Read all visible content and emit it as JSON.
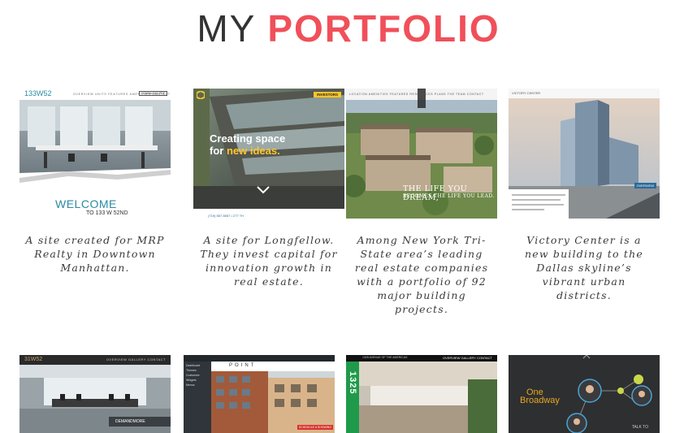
{
  "header": {
    "title_plain": "MY",
    "title_accent": "PORTFOLIO"
  },
  "row1": [
    {
      "caption": "A site created for MRP Realty in Downtown Manhattan.",
      "logo": "133W52",
      "nav": "OVERVIEW   UNITS   FEATURES   AMENITIES   CONTACT",
      "nav_button": "DOWNLOAD PDF",
      "welcome": "WELCOME",
      "address": "TO 133 W 52ND"
    },
    {
      "caption": "A site for Longfellow. They invest capital for innovation growth in real estate.",
      "button": "INVESTORS",
      "headline_1": "Creating space",
      "headline_2_prefix": "for ",
      "headline_2_accent": "new ideas.",
      "foot": "(719) 557-5557 • 277 TH"
    },
    {
      "caption": "Among New York Tri-State area’s leading real estate companies with a portfolio of 92 major building projects.",
      "nav": "LOCATION   AMENITIES   FEATURES   RESIDENCES   PLANS   THE TEAM   CONTACT",
      "tagline_1": "THE LIFE YOU DREAM,",
      "tagline_2": "BECOMES THE LIFE YOU LEAD."
    },
    {
      "caption": "Victory Center is a new building to the Dallas skyline’s vibrant urban districts.",
      "logo": "VICTORY CENTER",
      "badge": "OVERVIEW"
    }
  ],
  "row2": [
    {
      "logo": "31W52",
      "nav": "OVERVIEW   GALLERY   CONTACT",
      "tag": "DEMANDMORE"
    },
    {
      "brand": "POINT",
      "menu": [
        "Dashboard",
        "Themes",
        "Customize",
        "Widgets",
        "Menus"
      ],
      "tag": "SCHEDULE A SHOWING"
    },
    {
      "nav": "OVERVIEW   GALLERY   CONTACT",
      "address": "1325 AVENUE OF THE AMERICAS",
      "number": "1325"
    },
    {
      "logo_1": "One",
      "logo_2": "Broadway",
      "tag": "TALK TO"
    }
  ],
  "colors": {
    "accent": "#f0505a",
    "yellow": "#ffc629",
    "gold": "#e8a820",
    "teal": "#2a8aa2"
  }
}
